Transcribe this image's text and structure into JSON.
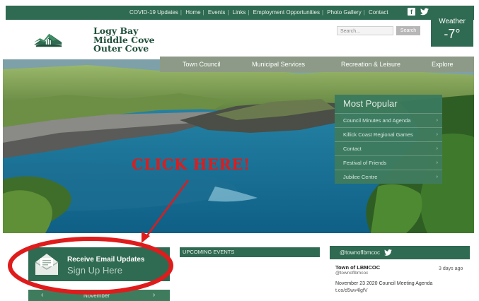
{
  "topbar": {
    "links": [
      "COVID-19 Updates",
      "Home",
      "Events",
      "Links",
      "Employment Opportunities",
      "Photo Gallery",
      "Contact"
    ],
    "facebook_icon": "facebook-icon",
    "twitter_icon": "twitter-icon"
  },
  "logo": {
    "line1": "Logy Bay",
    "line2": "Middle Cove",
    "line3": "Outer Cove"
  },
  "search": {
    "placeholder": "Search...",
    "button_label": "Search"
  },
  "weather": {
    "label": "Weather",
    "temperature": "-7°"
  },
  "nav": {
    "items": [
      "Town Council",
      "Municipal Services",
      "Recreation & Leisure",
      "Explore"
    ]
  },
  "most_popular": {
    "title": "Most Popular",
    "items": [
      "Council Minutes and Agenda",
      "Killick Coast Regional Games",
      "Contact",
      "Festival of Friends",
      "Jubilee Centre"
    ]
  },
  "annotation": {
    "text": "CLICK HERE!",
    "color": "#e01b1b"
  },
  "email_updates": {
    "title": "Receive Email Updates",
    "subtitle": "Sign Up Here"
  },
  "calendar": {
    "month": "November",
    "prev": "‹",
    "next": "›"
  },
  "events": {
    "heading": "UPCOMING EVENTS"
  },
  "twitter_feed": {
    "heading": "@townoflbmcoc",
    "tweet": {
      "name": "Town of LBMCOC",
      "handle": "@townoflbmcoc",
      "time": "3 days ago",
      "text": "November 23 2020 Council Meeting Agenda",
      "link": "t.co/d5wv4lgfV"
    }
  },
  "colors": {
    "brand_green": "#2f6a52",
    "nav_gray": "#8d9a87",
    "annotation_red": "#e01b1b"
  }
}
